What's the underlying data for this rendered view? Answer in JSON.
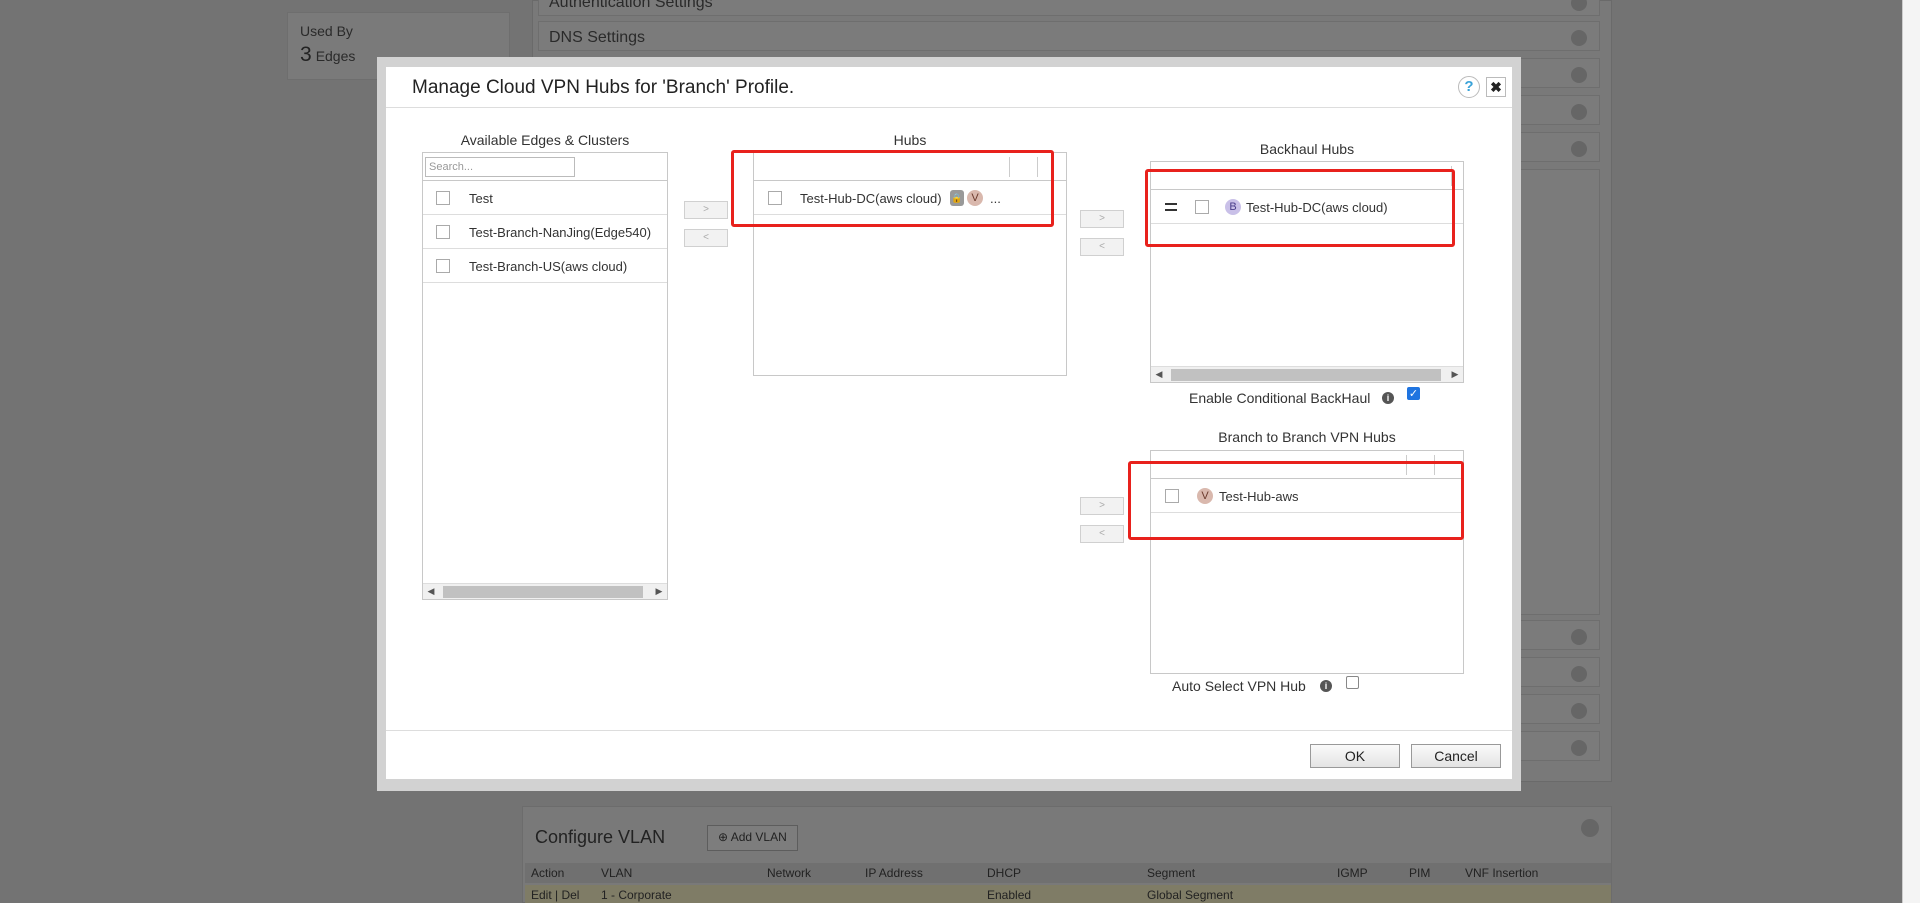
{
  "background": {
    "used_by_label": "Used By",
    "used_by_count": "3",
    "used_by_unit": "Edges",
    "rows": [
      "Authentication Settings",
      "DNS Settings"
    ],
    "vlan": {
      "title": "Configure VLAN",
      "add_button": "Add VLAN",
      "columns": [
        "Action",
        "VLAN",
        "Network",
        "IP Address",
        "DHCP",
        "Segment",
        "IGMP",
        "PIM",
        "VNF Insertion"
      ],
      "row": {
        "action": "Edit | Del",
        "vlan": "1 - Corporate",
        "dhcp": "Enabled",
        "segment": "Global Segment"
      }
    }
  },
  "modal": {
    "title": "Manage Cloud VPN Hubs for 'Branch' Profile.",
    "help_glyph": "?",
    "close_glyph": "✖",
    "available": {
      "title": "Available Edges & Clusters",
      "search_placeholder": "Search...",
      "items": [
        "Test",
        "Test-Branch-NanJing(Edge540)",
        "Test-Branch-US(aws cloud)"
      ]
    },
    "hubs": {
      "title": "Hubs",
      "items": [
        {
          "name": "Test-Hub-DC(aws cloud)",
          "badge": "V",
          "more": "..."
        }
      ]
    },
    "backhaul": {
      "title": "Backhaul Hubs",
      "items": [
        {
          "name": "Test-Hub-DC(aws cloud)",
          "badge": "B"
        }
      ],
      "conditional_label": "Enable Conditional BackHaul",
      "conditional_checked": true
    },
    "b2b": {
      "title": "Branch to Branch VPN Hubs",
      "items": [
        {
          "name": "Test-Hub-aws",
          "badge": "V"
        }
      ],
      "auto_select_label": "Auto Select VPN Hub",
      "auto_select_checked": false
    },
    "move_right": ">",
    "move_left": "<",
    "ok_label": "OK",
    "cancel_label": "Cancel"
  },
  "colors": {
    "highlight": "#e8211c",
    "badge_v": "#d9b8ad",
    "badge_b": "#c9c0e8",
    "check_blue": "#1f74e0"
  }
}
